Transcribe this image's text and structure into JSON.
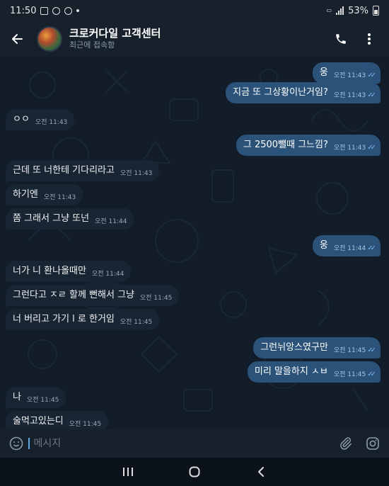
{
  "status": {
    "time": "11:50",
    "battery": "53%"
  },
  "header": {
    "title": "크로커다일 고객센터",
    "subtitle": "최근에 접속함"
  },
  "messages": [
    {
      "side": "out",
      "text": "웅",
      "time": "오전 11:43",
      "read": true
    },
    {
      "side": "out",
      "text": "지금 또 그상황이난거임?",
      "time": "오전 11:43",
      "read": true
    },
    {
      "side": "in",
      "text": "ㅇㅇ",
      "time": "오전 11:43"
    },
    {
      "side": "out",
      "text": "그 2500뺄때 그느낌?",
      "time": "오전 11:43",
      "read": true
    },
    {
      "side": "in",
      "text": "근데 또 너한테 기다리라고",
      "time": "오전 11:43"
    },
    {
      "side": "in",
      "text": "하기엔",
      "time": "오전 11:43"
    },
    {
      "side": "in",
      "text": "쫌 그래서 그냥 또넌",
      "time": "오전 11:44"
    },
    {
      "side": "out",
      "text": "웅",
      "time": "오전 11:44",
      "read": true
    },
    {
      "side": "in",
      "text": "너가 니 환나올때만",
      "time": "오전 11:44"
    },
    {
      "side": "in",
      "text": "그런다고 ㅈㄹ 할께 뻔해서 그냥",
      "time": "오전 11:45"
    },
    {
      "side": "in",
      "text": "너 버리고 가기 l 로 한거임",
      "time": "오전 11:45"
    },
    {
      "side": "out",
      "text": "그런뉘앙스였구만",
      "time": "오전 11:45",
      "read": true
    },
    {
      "side": "out",
      "text": "미리 말을하지 ㅅㅂ",
      "time": "오전 11:45",
      "read": true
    },
    {
      "side": "in",
      "text": "나",
      "time": "오전 11:45"
    },
    {
      "side": "in",
      "text": "술먹고있는디",
      "time": "오전 11:45"
    }
  ],
  "composer": {
    "placeholder": "메시지"
  },
  "icons": {
    "back": "arrow-left-icon",
    "call": "phone-icon",
    "menu": "more-vertical-icon",
    "emoji": "smiley-icon",
    "attach": "paperclip-icon",
    "camera": "instagram-camera-icon"
  },
  "colors": {
    "header_bg": "#17212b",
    "chat_bg": "#0e1621",
    "bubble_in": "#182533",
    "bubble_out": "#2b5278",
    "read_check": "#7fb8ee"
  }
}
